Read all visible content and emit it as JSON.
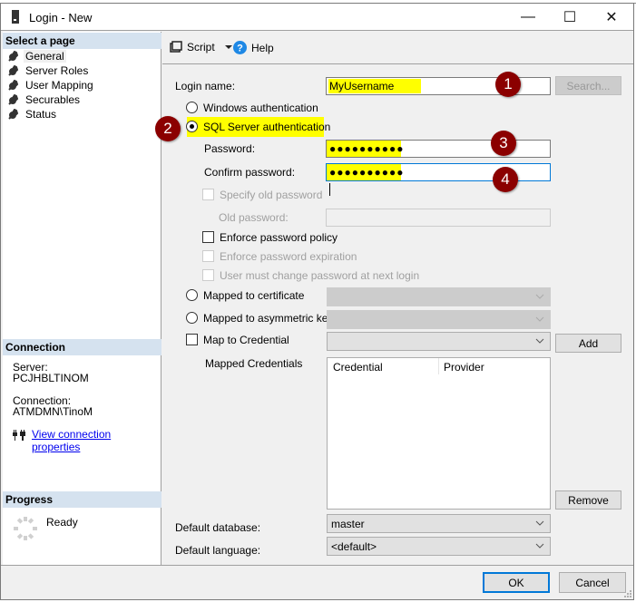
{
  "window": {
    "title": "Login - New",
    "controls": {
      "minimize": "—",
      "maximize": "☐",
      "close": "✕"
    }
  },
  "sidebar": {
    "select_page_header": "Select a page",
    "items": [
      {
        "label": "General",
        "selected": true
      },
      {
        "label": "Server Roles",
        "selected": false
      },
      {
        "label": "User Mapping",
        "selected": false
      },
      {
        "label": "Securables",
        "selected": false
      },
      {
        "label": "Status",
        "selected": false
      }
    ],
    "connection": {
      "header": "Connection",
      "server_label": "Server:",
      "server_value": "PCJHBLTINOM",
      "connection_label": "Connection:",
      "connection_value": "ATMDMN\\TinoM",
      "view_properties_link": "View connection properties"
    },
    "progress": {
      "header": "Progress",
      "status": "Ready"
    }
  },
  "toolbar": {
    "script_label": "Script",
    "help_label": "Help"
  },
  "form": {
    "login_name_label": "Login name:",
    "login_name_value": "MyUsername",
    "search_button": "Search...",
    "windows_auth_label": "Windows authentication",
    "sql_auth_label": "SQL Server authentication",
    "selected_auth": "SQL Server authentication",
    "password_label": "Password:",
    "password_value": "●●●●●●●●●●",
    "confirm_password_label": "Confirm password:",
    "confirm_password_value": "●●●●●●●●●●",
    "specify_old_password_label": "Specify old password",
    "old_password_label": "Old password:",
    "enforce_policy_label": "Enforce password policy",
    "enforce_policy_checked": false,
    "enforce_expiration_label": "Enforce password expiration",
    "must_change_label": "User must change password at next login",
    "mapped_certificate_label": "Mapped to certificate",
    "mapped_asymmetric_label": "Mapped to asymmetric key",
    "map_credential_label": "Map to Credential",
    "add_button": "Add",
    "mapped_credentials_label": "Mapped Credentials",
    "credentials_columns": [
      "Credential",
      "Provider"
    ],
    "remove_button": "Remove",
    "default_database_label": "Default database:",
    "default_database_value": "master",
    "default_language_label": "Default language:",
    "default_language_value": "<default>"
  },
  "annotations": [
    "1",
    "2",
    "3",
    "4"
  ],
  "footer": {
    "ok_button": "OK",
    "cancel_button": "Cancel"
  },
  "colors": {
    "highlight": "#ffff00",
    "badge": "#8b0000",
    "section_header": "#d5e2ef",
    "focus_border": "#0078d7",
    "link": "#0000ee"
  }
}
